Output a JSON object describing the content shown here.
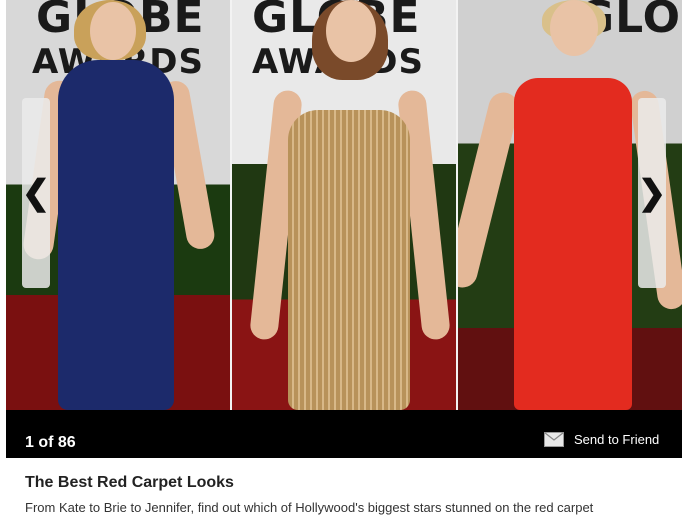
{
  "gallery": {
    "backdrop_words": [
      "GLOBE",
      "AWARDS"
    ],
    "photos": [
      {
        "alt": "Kate Winslet in navy gown"
      },
      {
        "alt": "Brie Larson in gold sequin gown"
      },
      {
        "alt": "Jennifer Lawrence in red gown"
      }
    ],
    "prev_icon": "chevron-left-icon",
    "next_icon": "chevron-right-icon",
    "prev_glyph": "❮",
    "next_glyph": "❯",
    "counter": "1 of 86",
    "send_to_friend": "Send to Friend",
    "send_icon": "envelope-icon",
    "title": "The Best Red Carpet Looks",
    "description": "From Kate to Brie to Jennifer, find out which of Hollywood's biggest stars stunned on the red carpet"
  },
  "colors": {
    "caption_bg": "#000000",
    "navy_dress": "#1c2a6b",
    "gold_dress": "#b8925a",
    "red_dress": "#e32b1f"
  }
}
